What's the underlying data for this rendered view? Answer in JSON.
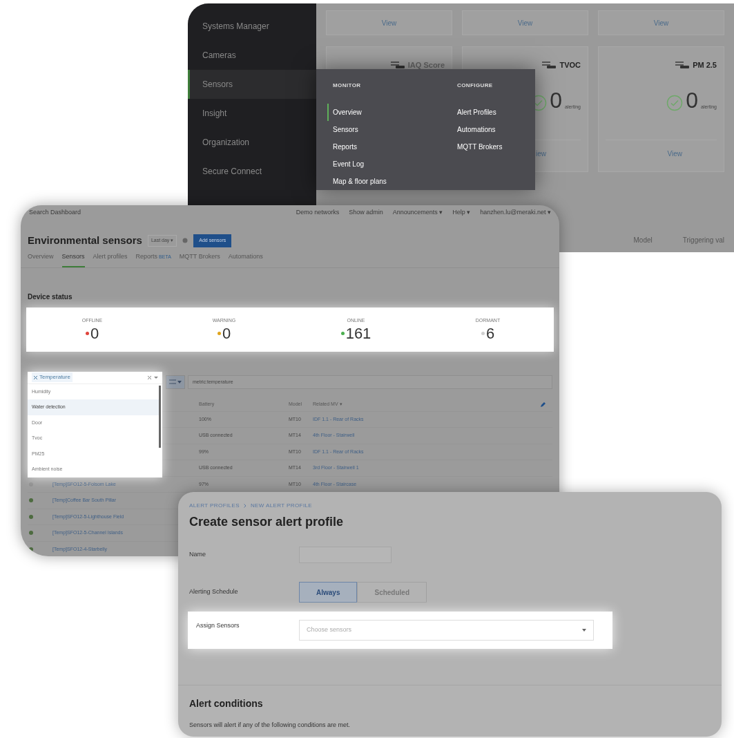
{
  "nav_panel": {
    "sidebar": [
      {
        "label": "Systems Manager",
        "selected": false
      },
      {
        "label": "Cameras",
        "selected": false
      },
      {
        "label": "Sensors",
        "selected": true
      },
      {
        "label": "Insight",
        "selected": false
      },
      {
        "label": "Organization",
        "selected": false
      },
      {
        "label": "Secure Connect",
        "selected": false
      }
    ],
    "view_links": [
      "View",
      "View",
      "View"
    ],
    "metric_cards": [
      {
        "title": "IAQ Score"
      },
      {
        "title": "TVOC",
        "count": "0",
        "caption": "alerting",
        "link": "iew"
      },
      {
        "title": "PM 2.5",
        "count": "0",
        "caption": "alerting",
        "link": "View"
      }
    ],
    "menu": [
      {
        "heading": "MONITOR",
        "items": [
          {
            "label": "Overview",
            "selected": true
          },
          {
            "label": "Sensors",
            "selected": false
          },
          {
            "label": "Reports",
            "selected": false
          },
          {
            "label": "Event Log",
            "selected": false
          },
          {
            "label": "Map & floor plans",
            "selected": false
          }
        ]
      },
      {
        "heading": "CONFIGURE",
        "items": [
          {
            "label": "Alert Profiles",
            "selected": false
          },
          {
            "label": "Automations",
            "selected": false
          },
          {
            "label": "MQTT Brokers",
            "selected": false
          }
        ]
      }
    ],
    "table_columns": [
      "Model",
      "Triggering val"
    ]
  },
  "dashboard": {
    "topbar": {
      "search": "Search Dashboard",
      "links": [
        "Demo networks",
        "Show admin",
        "Announcements ▾",
        "Help ▾",
        "hanzhen.lu@meraki.net ▾"
      ]
    },
    "title": "Environmental sensors",
    "timespan": "Last day ▾",
    "add_button": "Add sensors",
    "tabs": [
      {
        "label": "Overview",
        "selected": false
      },
      {
        "label": "Sensors",
        "selected": true
      },
      {
        "label": "Alert profiles",
        "selected": false
      },
      {
        "label": "Reports",
        "badge": "BETA",
        "selected": false
      },
      {
        "label": "MQTT Brokers",
        "selected": false
      },
      {
        "label": "Automations",
        "selected": false
      }
    ],
    "status_heading": "Device status",
    "status": [
      {
        "label": "OFFLINE",
        "count": "0",
        "color": "#e0443c"
      },
      {
        "label": "WARNING",
        "count": "0",
        "color": "#e0a41c"
      },
      {
        "label": "ONLINE",
        "count": "161",
        "color": "#4caf50"
      },
      {
        "label": "DORMANT",
        "count": "6",
        "color": "#cfcfcf"
      }
    ],
    "metric_filter": {
      "chip": "Temperature",
      "options": [
        {
          "label": "Humidity",
          "selected": false
        },
        {
          "label": "Water detection",
          "selected": true
        },
        {
          "label": "Door",
          "selected": false
        },
        {
          "label": "Tvoc",
          "selected": false
        },
        {
          "label": "PM25",
          "selected": false
        },
        {
          "label": "Ambient noise",
          "selected": false
        }
      ]
    },
    "search": {
      "value": "metric:temperature"
    },
    "table": {
      "columns": [
        "Battery",
        "Model",
        "Related MV ▾"
      ],
      "rows": [
        {
          "battery": "100%",
          "model": "MT10",
          "mv": "IDF 1.1 - Rear of Racks"
        },
        {
          "battery": "USB connected",
          "model": "MT14",
          "mv": "4th Floor - Stairwell"
        },
        {
          "battery": "99%",
          "model": "MT10",
          "mv": "IDF 1.1 - Rear of Racks"
        },
        {
          "battery": "USB connected",
          "model": "MT14",
          "mv": "3rd Floor - Stairwell 1"
        },
        {
          "color": "#8c8c8c",
          "name": "[Temp]SFO12-5-Folsom Lake",
          "battery": "97%",
          "model": "MT10",
          "mv": "4th Floor - Staircase"
        },
        {
          "color": "#4d6b40",
          "name": "[Temp]Coffee Bar South Pillar"
        },
        {
          "color": "#4d6b40",
          "name": "[Temp]SFO12-5-Lighthouse Field"
        },
        {
          "color": "#4d6b40",
          "name": "[Temp]SFO12-5-Channel Islands"
        },
        {
          "color": "#4d6b40",
          "name": "[Temp]SFO12-4-Starbelly"
        }
      ]
    }
  },
  "alert_profile": {
    "breadcrumb": [
      "ALERT PROFILES",
      "NEW ALERT PROFILE"
    ],
    "title": "Create sensor alert profile",
    "name_label": "Name",
    "schedule_label": "Alerting Schedule",
    "schedule_options": [
      {
        "label": "Always",
        "selected": true
      },
      {
        "label": "Scheduled",
        "selected": false
      }
    ],
    "assign_label": "Assign Sensors",
    "assign_placeholder": "Choose sensors",
    "conditions_heading": "Alert conditions",
    "conditions_text": "Sensors will alert if any of the following conditions are met."
  }
}
